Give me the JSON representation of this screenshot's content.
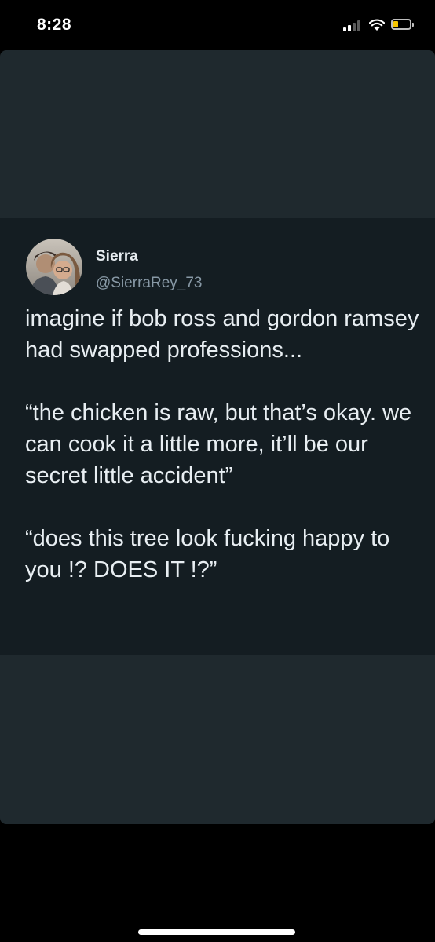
{
  "status_bar": {
    "time": "8:28",
    "signal_icon": "cellular-signal-icon",
    "wifi_icon": "wifi-icon",
    "battery_icon": "battery-icon",
    "battery_color": "#f5c400"
  },
  "tweet": {
    "author_name": "Sierra",
    "author_handle": "@SierraRey_73",
    "paragraphs": [
      "imagine if bob ross and gordon ramsey had swapped professions...",
      "“the chicken is raw, but that’s okay. we can cook it a little more, it’ll be our secret little accident”",
      "“does this tree look fucking happy to you !? DOES IT !?”"
    ]
  },
  "colors": {
    "screen_background": "#000000",
    "photo_background": "#1f292e",
    "tweet_background": "#141d22",
    "name_color": "#e6ecf0",
    "handle_color": "#8899a6",
    "text_color": "#e8eef2"
  }
}
